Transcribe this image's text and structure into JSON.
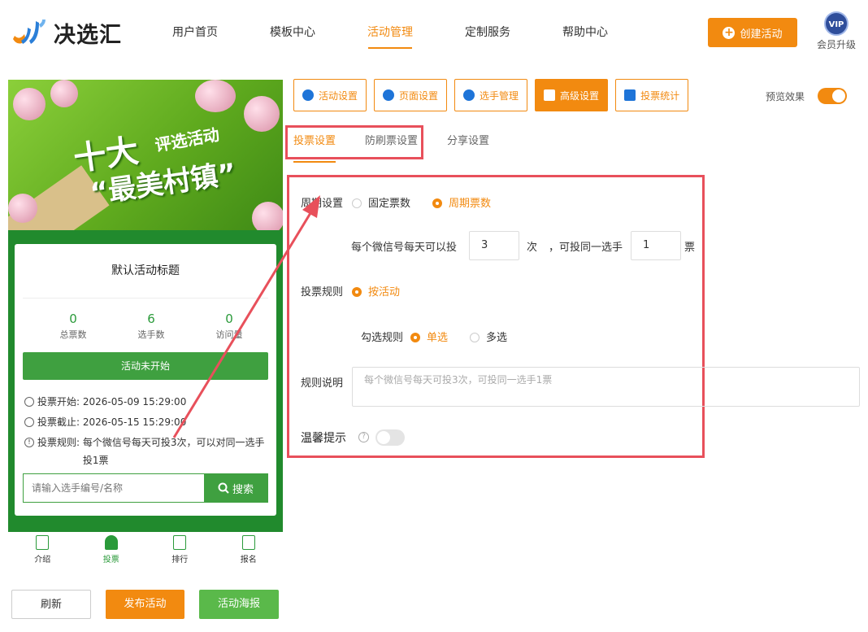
{
  "brand": {
    "name": "决选汇"
  },
  "nav": {
    "items": [
      "用户首页",
      "模板中心",
      "活动管理",
      "定制服务",
      "帮助中心"
    ],
    "active_index": 2
  },
  "create_button": "创建活动",
  "vip": {
    "badge": "VIP",
    "label": "会员升级"
  },
  "preview": {
    "banner": {
      "line1": "十大",
      "line2": "评选活动",
      "line3": "“最美村镇”"
    },
    "card_title": "默认活动标题",
    "stats": [
      {
        "value": "0",
        "label": "总票数"
      },
      {
        "value": "6",
        "label": "选手数"
      },
      {
        "value": "0",
        "label": "访问量"
      }
    ],
    "status_button": "活动未开始",
    "vote_start_label": "投票开始:",
    "vote_start": "2026-05-09 15:29:00",
    "vote_end_label": "投票截止:",
    "vote_end": "2026-05-15 15:29:00",
    "vote_rule_label": "投票规则:",
    "vote_rule": "每个微信号每天可投3次，可以对同一选手投1票",
    "search_placeholder": "请输入选手编号/名称",
    "search_button": "搜索",
    "bottom_tabs": [
      "介绍",
      "投票",
      "排行",
      "报名"
    ],
    "bottom_active_index": 1
  },
  "footer": {
    "refresh": "刷新",
    "publish": "发布活动",
    "poster": "活动海报"
  },
  "settings_tabs": [
    "活动设置",
    "页面设置",
    "选手管理",
    "高级设置",
    "投票统计"
  ],
  "settings_active_index": 3,
  "preview_toggle": {
    "label": "预览效果",
    "on": true
  },
  "subtabs": [
    "投票设置",
    "防刷票设置",
    "分享设置"
  ],
  "subtab_active_index": 0,
  "form": {
    "cycle_label": "周期设置",
    "cycle_options": [
      "固定票数",
      "周期票数"
    ],
    "cycle_selected": 1,
    "per_day_prefix": "每个微信号每天可以投",
    "per_day_value": "3",
    "per_day_unit": "次",
    "same_player_prefix": "，可投同一选手",
    "same_player_value": "1",
    "same_player_unit": "票",
    "rule_label": "投票规则",
    "rule_option": "按活动",
    "check_rule_label": "勾选规则",
    "check_options": [
      "单选",
      "多选"
    ],
    "check_selected": 0,
    "desc_label": "规则说明",
    "desc_placeholder": "每个微信号每天可投3次，可投同一选手1票",
    "tip_label": "温馨提示",
    "tip_help": "?",
    "tip_on": false
  },
  "colors": {
    "accent": "#f28a10",
    "green": "#3fa040",
    "annotation": "#e8505b"
  }
}
